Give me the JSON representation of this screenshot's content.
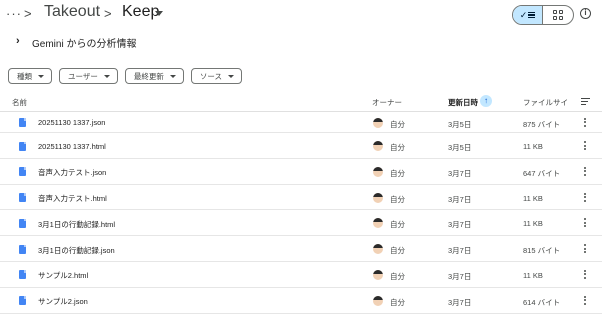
{
  "breadcrumb": {
    "more": "···",
    "separator": ">",
    "items": [
      "Takeout",
      "Keep"
    ]
  },
  "gemini": {
    "label": "Gemini からの分析情報"
  },
  "filters": [
    "種類",
    "ユーザー",
    "最終更新",
    "ソース"
  ],
  "columns": {
    "name": "名前",
    "owner": "オーナー",
    "modified": "更新日時",
    "size": "ファイルサイ"
  },
  "files": [
    {
      "name": "20251130 1337.json",
      "owner": "自分",
      "modified": "3月5日",
      "size": "875 バイト"
    },
    {
      "name": "20251130 1337.html",
      "owner": "自分",
      "modified": "3月5日",
      "size": "11 KB"
    },
    {
      "name": "音声入力テスト.json",
      "owner": "自分",
      "modified": "3月7日",
      "size": "647 バイト"
    },
    {
      "name": "音声入力テスト.html",
      "owner": "自分",
      "modified": "3月7日",
      "size": "11 KB"
    },
    {
      "name": "3月1日の行動記録.html",
      "owner": "自分",
      "modified": "3月7日",
      "size": "11 KB"
    },
    {
      "name": "3月1日の行動記録.json",
      "owner": "自分",
      "modified": "3月7日",
      "size": "815 バイト"
    },
    {
      "name": "サンプル2.html",
      "owner": "自分",
      "modified": "3月7日",
      "size": "11 KB"
    },
    {
      "name": "サンプル2.json",
      "owner": "自分",
      "modified": "3月7日",
      "size": "614 バイト"
    }
  ],
  "colors": {
    "accent": "#0b57d0",
    "selected_bg": "#c2e7ff",
    "file_icon": "#4285f4"
  },
  "icons": [
    "more-horiz-icon",
    "chevron-right-icon",
    "dropdown-caret-icon",
    "check-icon",
    "list-view-icon",
    "grid-view-icon",
    "info-icon",
    "sort-arrow-up-icon",
    "sort-options-icon",
    "file-icon",
    "avatar",
    "kebab-menu-icon"
  ]
}
